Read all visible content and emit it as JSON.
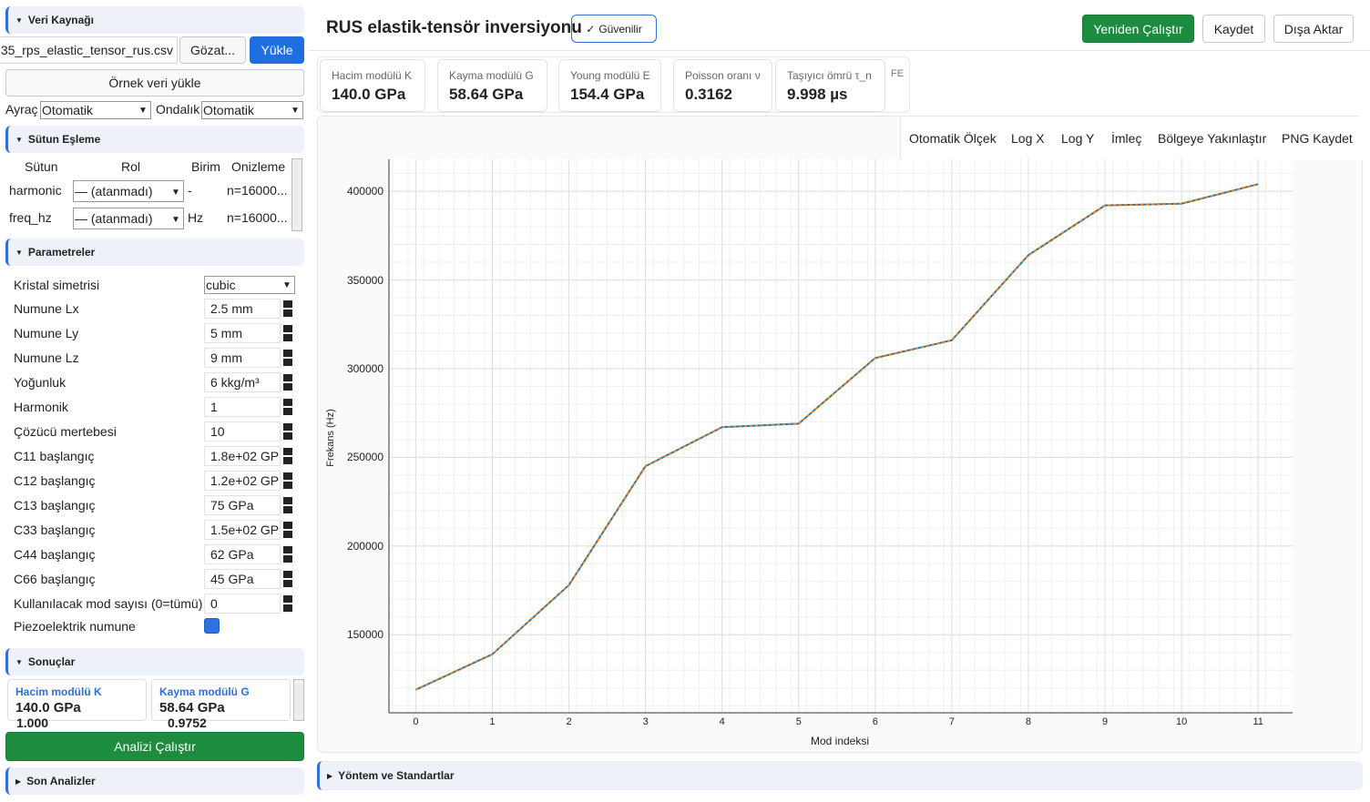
{
  "sidebar": {
    "data_source": {
      "header": "Veri Kaynağı",
      "file_value": "35_rps_elastic_tensor_rus.csv",
      "browse_label": "Gözat...",
      "load_label": "Yükle",
      "sample_label": "Örnek veri yükle",
      "delimiter_label": "Ayraç",
      "delimiter_value": "Otomatik",
      "decimal_label": "Ondalık",
      "decimal_value": "Otomatik"
    },
    "column_mapping": {
      "header": "Sütun Eşleme",
      "columns": [
        "Sütun",
        "Rol",
        "Birim",
        "Onizleme"
      ],
      "rows": [
        {
          "column": "harmonic",
          "role": "— (atanmadı)",
          "unit": "-",
          "preview": "n=16000..."
        },
        {
          "column": "freq_hz",
          "role": "— (atanmadı)",
          "unit": "Hz",
          "preview": "n=16000..."
        }
      ]
    },
    "parameters": {
      "header": "Parametreler",
      "symmetry_label": "Kristal simetrisi",
      "symmetry_value": "cubic",
      "fields": [
        {
          "label": "Numune Lx",
          "value": "2.5 mm"
        },
        {
          "label": "Numune Ly",
          "value": "5 mm"
        },
        {
          "label": "Numune Lz",
          "value": "9 mm"
        },
        {
          "label": "Yoğunluk",
          "value": "6 kkg/m³"
        },
        {
          "label": "Harmonik",
          "value": "1"
        },
        {
          "label": "Çözücü mertebesi",
          "value": "10"
        },
        {
          "label": "C11 başlangıç",
          "value": "1.8e+02 GP"
        },
        {
          "label": "C12 başlangıç",
          "value": "1.2e+02 GP"
        },
        {
          "label": "C13 başlangıç",
          "value": "75 GPa"
        },
        {
          "label": "C33 başlangıç",
          "value": "1.5e+02 GP"
        },
        {
          "label": "C44 başlangıç",
          "value": "62 GPa"
        },
        {
          "label": "C66 başlangıç",
          "value": "45 GPa"
        },
        {
          "label": "Kullanılacak mod sayısı (0=tümü)",
          "value": "0"
        }
      ],
      "piezo_label": "Piezoelektrik numune",
      "piezo_checked": true
    },
    "results": {
      "header": "Sonuçlar",
      "cards": [
        {
          "title": "Hacim modülü K",
          "value": "140.0 GPa",
          "under": "1.000"
        },
        {
          "title": "Kayma modülü G",
          "value": "58.64 GPa",
          "under": "0.9752"
        }
      ],
      "run_label": "Analizi Çalıştır"
    },
    "recent": {
      "header": "Son Analizler"
    }
  },
  "header": {
    "title": "RUS elastik-tensör inversiyonu",
    "badge": "Güvenilir",
    "badge_icon": "✓",
    "rerun_label": "Yeniden Çalıştır",
    "save_label": "Kaydet",
    "export_label": "Dışa Aktar"
  },
  "metrics": [
    {
      "title": "Hacim modülü K",
      "value": "140.0 GPa"
    },
    {
      "title": "Kayma modülü G",
      "value": "58.64 GPa"
    },
    {
      "title": "Young modülü E",
      "value": "154.4 GPa"
    },
    {
      "title": "Poisson oranı ν",
      "value": "0.3162"
    },
    {
      "title": "Taşıyıcı ömrü τ_n",
      "value": "9.998 µs"
    }
  ],
  "metrics_overflow": "FE",
  "toolbar": {
    "autoscale": "Otomatik Ölçek",
    "logx": "Log X",
    "logy": "Log Y",
    "cursor": "İmleç",
    "zoom": "Bölgeye Yakınlaştır",
    "png": "PNG Kaydet"
  },
  "chart_data": {
    "type": "line",
    "xlabel": "Mod indeksi",
    "ylabel": "Frekans (Hz)",
    "x": [
      0,
      1,
      2,
      3,
      4,
      5,
      6,
      7,
      8,
      9,
      10,
      11
    ],
    "series": [
      {
        "values": [
          119000,
          139000,
          178000,
          245000,
          267000,
          269000,
          306000,
          316000,
          364000,
          392000,
          393000,
          404000
        ],
        "color": "#1f77b4"
      },
      {
        "values": [
          119000,
          139000,
          178000,
          245000,
          267000,
          269000,
          306000,
          316000,
          364000,
          392000,
          393000,
          404000
        ],
        "color": "#ff7f0e"
      }
    ],
    "xlim": [
      -0.35,
      11.45
    ],
    "ylim": [
      106000,
      418000
    ],
    "yticks": [
      150000,
      200000,
      250000,
      300000,
      350000,
      400000
    ],
    "grid": true
  },
  "footer": {
    "methods": "Yöntem ve Standartlar"
  }
}
